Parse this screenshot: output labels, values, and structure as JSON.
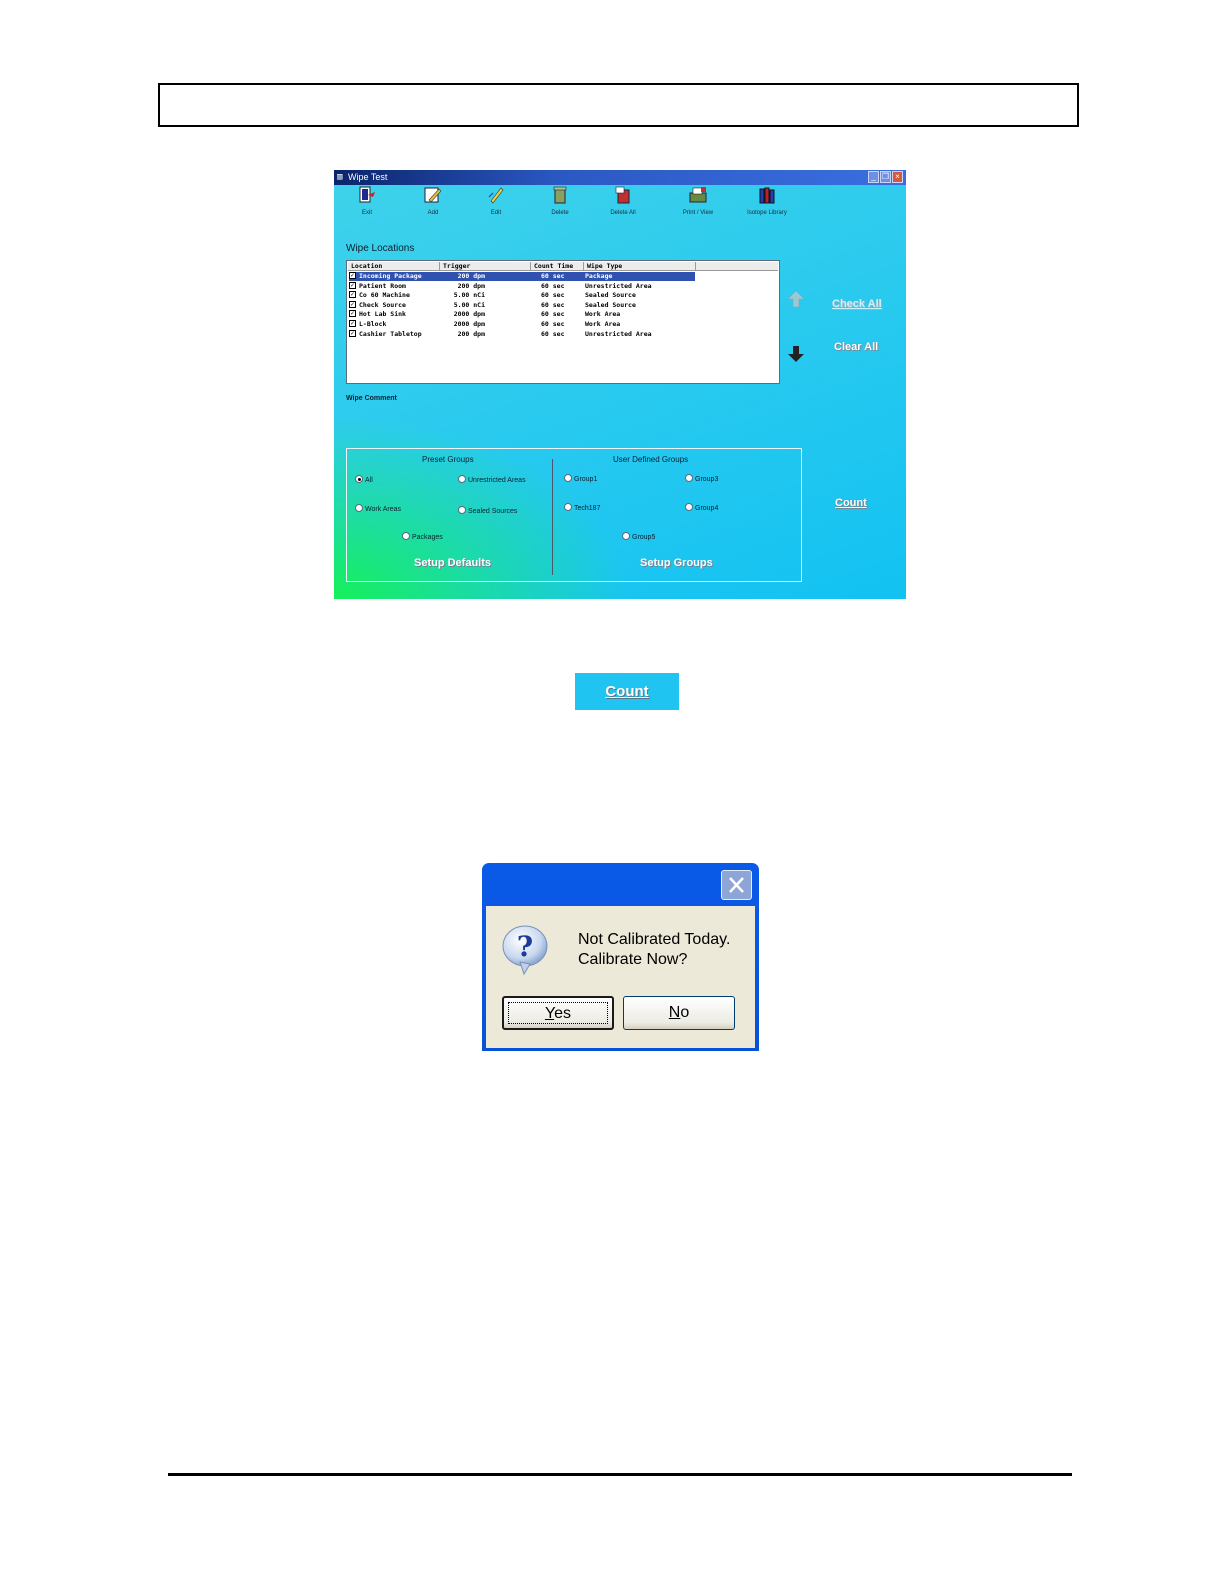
{
  "wipe_window": {
    "title": "Wipe Test",
    "toolbar": [
      {
        "label": "Exit",
        "icon": "exit-icon"
      },
      {
        "label": "Add",
        "icon": "add-icon"
      },
      {
        "label": "Edit",
        "icon": "edit-icon"
      },
      {
        "label": "Delete",
        "icon": "delete-icon"
      },
      {
        "label": "Delete All",
        "icon": "delete-all-icon"
      },
      {
        "label": "Print / View",
        "icon": "print-view-icon"
      },
      {
        "label": "Isotope Library",
        "icon": "isotope-library-icon"
      }
    ],
    "locations_label": "Wipe Locations",
    "columns": [
      "Location",
      "Trigger",
      "Count Time",
      "Wipe Type"
    ],
    "rows": [
      {
        "location": "Incoming Package",
        "trigger": "200 dpm",
        "count_time": "60 sec",
        "wipe_type": "Package",
        "selected": true
      },
      {
        "location": "Patient Room",
        "trigger": "200 dpm",
        "count_time": "60 sec",
        "wipe_type": "Unrestricted Area",
        "selected": false
      },
      {
        "location": "Co 60 Machine",
        "trigger": "5.00 nCi",
        "count_time": "60 sec",
        "wipe_type": "Sealed Source",
        "selected": false
      },
      {
        "location": "Check Source",
        "trigger": "5.00 nCi",
        "count_time": "60 sec",
        "wipe_type": "Sealed Source",
        "selected": false
      },
      {
        "location": "Hot Lab Sink",
        "trigger": "2000 dpm",
        "count_time": "60 sec",
        "wipe_type": "Work Area",
        "selected": false
      },
      {
        "location": "L-Block",
        "trigger": "2000 dpm",
        "count_time": "60 sec",
        "wipe_type": "Work Area",
        "selected": false
      },
      {
        "location": "Cashier Tabletop",
        "trigger": "200 dpm",
        "count_time": "60 sec",
        "wipe_type": "Unrestricted Area",
        "selected": false
      }
    ],
    "check_all": "Check All",
    "clear_all": "Clear All",
    "wipe_comment_label": "Wipe Comment",
    "preset_groups": {
      "title": "Preset Groups",
      "options": [
        "All",
        "Unrestricted Areas",
        "Work Areas",
        "Sealed Sources",
        "Packages"
      ],
      "selected": "All",
      "setup_button": "Setup Defaults"
    },
    "user_groups": {
      "title": "User Defined Groups",
      "options": [
        "Group1",
        "Group3",
        "Tech187",
        "Group4",
        "Group5"
      ],
      "setup_button": "Setup Groups"
    },
    "count_button": "Count"
  },
  "count_button_zoom": "Count",
  "message_box": {
    "line1": "Not Calibrated Today.",
    "line2": "Calibrate Now?",
    "yes": "Yes",
    "no": "No"
  },
  "colors": {
    "window_cyan": "#27c9ef",
    "window_green": "#16f05a",
    "selection_blue": "#2f52b0",
    "xp_blue": "#0a5ae8",
    "dialog_face": "#ece9d8"
  }
}
